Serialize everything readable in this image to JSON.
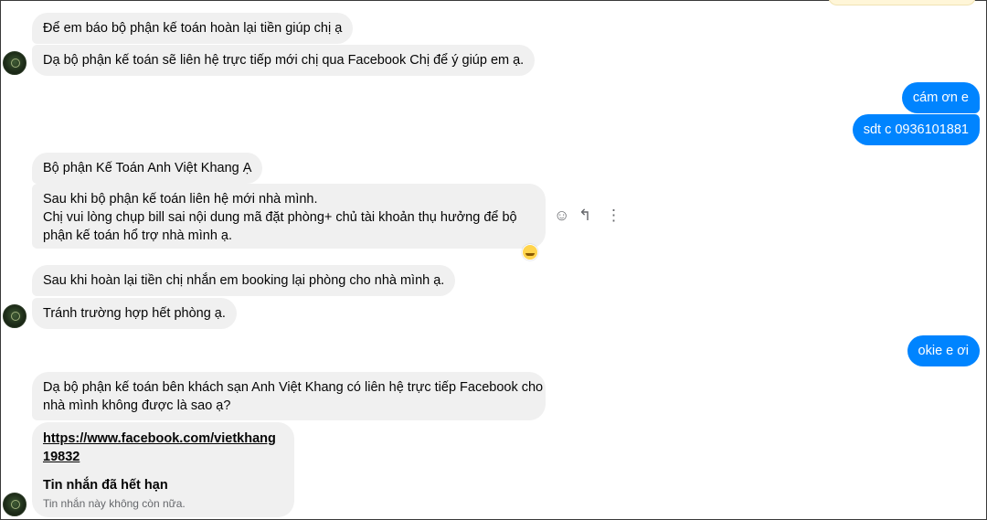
{
  "conversation": {
    "incoming_group_1": [
      "Để em báo bộ phận kế toán hoàn lại tiền giúp chị ạ",
      "Dạ bộ phận kế toán sẽ liên hệ trực tiếp mới chị qua Facebook Chị để ý giúp em ạ."
    ],
    "outgoing_group_1": [
      "cám ơn e",
      "sdt c 0936101881"
    ],
    "incoming_group_2": [
      "Bộ phận Kế Toán Anh Việt Khang Ạ",
      "Sau khi bộ phận kế toán liên hệ mới nhà mình.",
      "Chị vui lòng chụp bill sai nội dung mã đặt phòng+ chủ tài khoản thụ hưởng để bộ",
      "phận kế toán hổ trợ nhà mình ạ."
    ],
    "incoming_group_3": [
      "Sau khi hoàn lại tiền chị nhắn em booking lại phòng cho nhà mình ạ.",
      "Tránh trường hợp hết phòng ạ."
    ],
    "outgoing_group_2": [
      "okie e ơi"
    ],
    "incoming_group_4": [
      "Dạ bộ phận kế toán bên khách sạn Anh Việt Khang có liên hệ trực tiếp Facebook cho",
      "nhà mình không được là sao ạ?"
    ],
    "link_card": {
      "url": "https://www.facebook.com/vietkhang19832",
      "expired_title": "Tin nhắn đã hết hạn",
      "expired_subtitle": "Tin nhắn này không còn nữa."
    }
  },
  "message_actions": {
    "react_icon": "smiley-icon",
    "reply_icon": "reply-icon",
    "more_icon": "more-vertical-icon",
    "react_symbol": "☺",
    "reply_symbol": "↰",
    "more_symbol": "⋮"
  },
  "colors": {
    "incoming_bubble": "#f0f0f0",
    "outgoing_bubble": "#0084ff",
    "icon_gray": "#65676b"
  }
}
